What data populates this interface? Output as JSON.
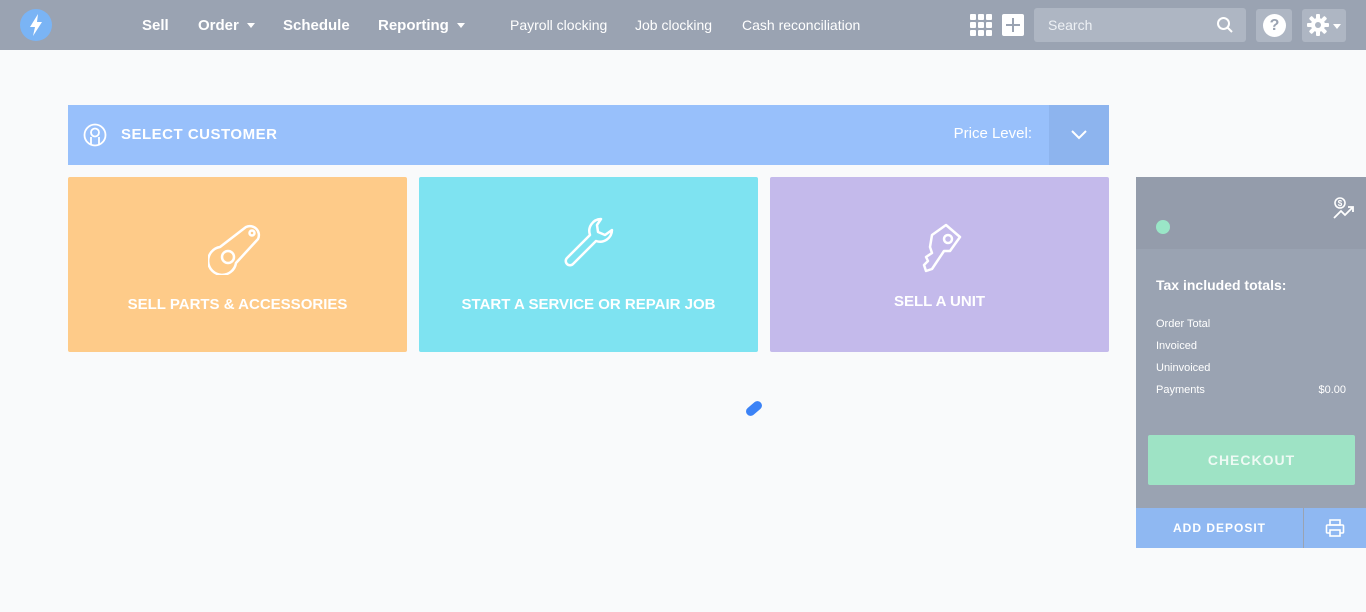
{
  "nav": {
    "main": [
      {
        "label": "Sell",
        "has_caret": false
      },
      {
        "label": "Order",
        "has_caret": true
      },
      {
        "label": "Schedule",
        "has_caret": false
      },
      {
        "label": "Reporting",
        "has_caret": true
      }
    ],
    "sub": [
      "Payroll clocking",
      "Job clocking",
      "Cash reconciliation"
    ],
    "search_placeholder": "Search",
    "help_label": "?"
  },
  "customer": {
    "select_label": "SELECT CUSTOMER",
    "price_level_label": "Price Level:"
  },
  "tiles": [
    {
      "label": "SELL PARTS & ACCESSORIES",
      "icon": "parts-icon",
      "color": "#fecb89"
    },
    {
      "label": "START A SERVICE OR REPAIR JOB",
      "icon": "wrench-icon",
      "color": "#7ee3f1"
    },
    {
      "label": "SELL A UNIT",
      "icon": "key-icon",
      "color": "#c4baeb"
    }
  ],
  "panel": {
    "totals_title": "Tax included totals:",
    "rows": [
      {
        "label": "Order Total",
        "value": ""
      },
      {
        "label": "Invoiced",
        "value": ""
      },
      {
        "label": "Uninvoiced",
        "value": ""
      },
      {
        "label": "Payments",
        "value": "$0.00"
      }
    ],
    "checkout_label": "CHECKOUT",
    "deposit_label": "ADD DEPOSIT"
  },
  "colors": {
    "topbar": "#9aa3b2",
    "customer_bar": "#98c0fb",
    "checkout": "#9ee3c5",
    "status_dot": "#9ae6c7"
  }
}
